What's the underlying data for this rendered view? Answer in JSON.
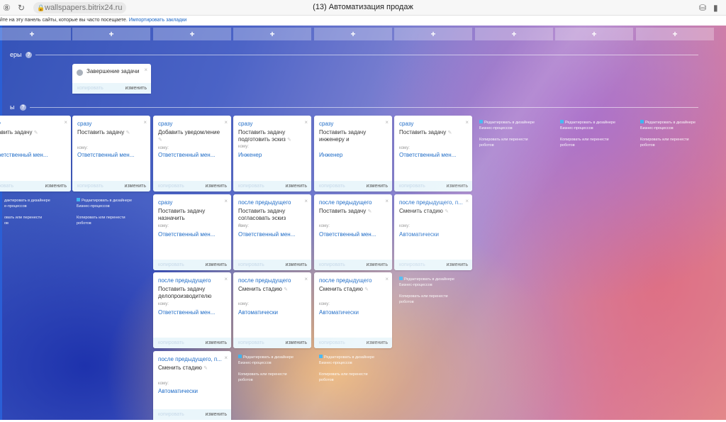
{
  "browser": {
    "url": "wallspapers.bitrix24.ru",
    "title": "(13) Автоматизация продаж",
    "bookmarks_text": "йте на эту панель сайты, которые вы часто посещаете.",
    "bookmarks_link": "Импортировать закладки"
  },
  "add_label": "+",
  "sections": {
    "triggers": "еры",
    "robots": "ы"
  },
  "trigger": {
    "name": "Завершение задачи",
    "copy": "копировать",
    "edit": "изменить"
  },
  "col0": {
    "card1": {
      "when": "у",
      "title": "авить задачу",
      "to_label": "",
      "to": "ветственный мен...",
      "copy": "ровать",
      "edit": "изменить"
    },
    "links": {
      "designer": "дактировать в дизайнере",
      "designer2": "е-процессов",
      "move": "овать или перенести",
      "move2": "ов"
    }
  },
  "col1": {
    "card1": {
      "when": "сразу",
      "title": "Поставить задачу",
      "to_label": "кому:",
      "to": "Ответственный мен...",
      "copy": "копировать",
      "edit": "изменить"
    },
    "links": {
      "designer": "Редактировать в дизайнере",
      "designer2": "Бизнес-процессов",
      "move": "Копировать или перенести",
      "move2": "роботов"
    }
  },
  "col2": {
    "card1": {
      "when": "сразу",
      "title": "Добавить уведомление",
      "to_label": "кому:",
      "to": "Ответственный мен...",
      "copy": "копировать",
      "edit": "изменить"
    },
    "card2": {
      "when": "сразу",
      "title": "Поставить задачу назначить",
      "to_label": "кому:",
      "to": "Ответственный мен...",
      "copy": "копировать",
      "edit": "изменить"
    },
    "card3": {
      "when": "после предыдущего",
      "title": "Поставить задачу делопроизводителю",
      "to_label": "кому:",
      "to": "Ответственный мен...",
      "copy": "копировать",
      "edit": "изменить"
    },
    "card4": {
      "when": "после предыдущего, п...",
      "title": "Сменить стадию",
      "to_label": "кому:",
      "to": "Автоматически",
      "copy": "копировать",
      "edit": "изменить"
    }
  },
  "col3": {
    "card1": {
      "when": "сразу",
      "title": "Поставить задачу подготовить эскиз",
      "to_label": "кому:",
      "to": "Инженер",
      "copy": "копировать",
      "edit": "изменить"
    },
    "card2": {
      "when": "после предыдущего",
      "title": "Поставить задачу согласовать эскиз",
      "to_label": "кому:",
      "to": "Ответственный мен...",
      "copy": "копировать",
      "edit": "изменить"
    },
    "card3": {
      "when": "после предыдущего",
      "title": "Сменить стадию",
      "to_label": "кому:",
      "to": "Автоматически",
      "copy": "копировать",
      "edit": "изменить"
    },
    "links": {
      "designer": "Редактировать в дизайнере",
      "designer2": "Бизнес-процессов",
      "move": "Копировать или перенести",
      "move2": "роботов"
    }
  },
  "col4": {
    "card1": {
      "when": "сразу",
      "title": "Поставить задачу инженеру и",
      "to_label": "кому:",
      "to": "Инженер",
      "copy": "копировать",
      "edit": "изменить"
    },
    "card2": {
      "when": "после предыдущего",
      "title": "Поставить задачу",
      "to_label": "кому:",
      "to": "Ответственный мен...",
      "copy": "копировать",
      "edit": "изменить"
    },
    "card3": {
      "when": "после предыдущего",
      "title": "Сменить стадию",
      "to_label": "кому:",
      "to": "Автоматически",
      "copy": "копировать",
      "edit": "изменить"
    },
    "links": {
      "designer": "Редактировать в дизайнере",
      "designer2": "Бизнес-процессов",
      "move": "Копировать или перенести",
      "move2": "роботов"
    }
  },
  "col5": {
    "card1": {
      "when": "сразу",
      "title": "Поставить задачу",
      "to_label": "кому:",
      "to": "Ответственный мен...",
      "copy": "копировать",
      "edit": "изменить"
    },
    "card2": {
      "when": "после предыдущего, п...",
      "title": "Сменить стадию",
      "to_label": "кому:",
      "to": "Автоматически",
      "copy": "копировать",
      "edit": "изменить"
    },
    "links": {
      "designer": "Редактировать в дизайнере",
      "designer2": "Бизнес-процессов",
      "move": "Копировать или перенести",
      "move2": "роботов"
    }
  },
  "col6": {
    "links": {
      "designer": "Редактировать в дизайнере",
      "designer2": "Бизнес-процессов",
      "move": "Копировать или перенести",
      "move2": "роботов"
    }
  },
  "col7": {
    "links": {
      "designer": "Редактировать в дизайнере",
      "designer2": "Бизнес-процессов",
      "move": "Копировать или перенести",
      "move2": "роботов"
    }
  },
  "col8": {
    "links": {
      "designer": "Редактировать в дизайнере",
      "designer2": "Бизнес-процессов",
      "move": "Копировать или перенести",
      "move2": "роботов"
    }
  }
}
